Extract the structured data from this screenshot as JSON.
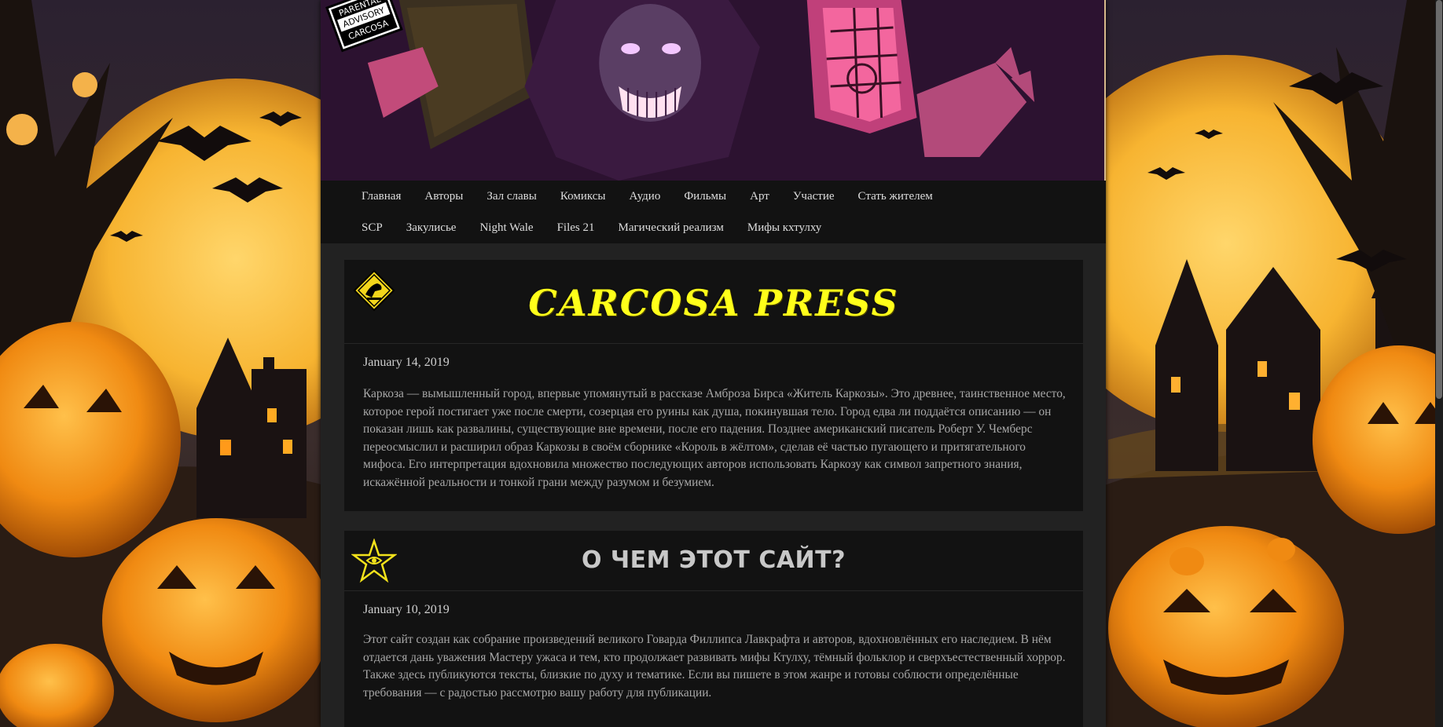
{
  "banner": {
    "advisory_line1": "PARENTAL",
    "advisory_line2": "ADVISORY",
    "advisory_line3": "CARCOSA"
  },
  "nav": {
    "row1": [
      "Главная",
      "Авторы",
      "Зал славы",
      "Комиксы",
      "Аудио",
      "Фильмы",
      "Арт",
      "Участие",
      "Стать жителем"
    ],
    "row2": [
      "SCP",
      "Закулисье",
      "Night Wale",
      "Files 21",
      "Магический реализм",
      "Мифы кхтулху"
    ]
  },
  "posts": [
    {
      "title": "CARCOSA PRESS",
      "icon": "warning-sign-icon",
      "date": "January 14, 2019",
      "body": "Каркоза — вымышленный город, впервые упомянутый в рассказе Амброза Бирса «Житель Каркозы». Это древнее, таинственное место, которое герой постигает уже после смерти, созерцая его руины как душа, покинувшая тело. Город едва ли поддаётся описанию — он показан лишь как развалины, существующие вне времени, после его падения. Позднее американский писатель Роберт У. Чемберс переосмыслил и расширил образ Каркозы в своём сборнике «Король в жёлтом», сделав её частью пугающего и притягательного мифоса. Его интерпретация вдохновила множество последующих авторов использовать Каркозу как символ запретного знания, искажённой реальности и тонкой грани между разумом и безумием."
    },
    {
      "title": "О ЧЕМ ЭТОТ САЙТ?",
      "icon": "elder-sign-icon",
      "date": "January 10, 2019",
      "body": "Этот сайт создан как собрание произведений великого Говарда Филлипса Лавкрафта и авторов, вдохновлённых его наследием. В нём отдается дань уважения Мастеру ужаса и тем, кто продолжает развивать мифы Ктулху, тёмный фольклор и сверхъестественный хоррор. Также здесь публикуются тексты, близкие по духу и тематике. Если вы пишете в этом жанре и готовы соблюсти определённые требования — с радостью рассмотрю вашу работу для публикации."
    }
  ],
  "colors": {
    "title_yellow": "#ffff1a",
    "page_bg": "#222222",
    "post_bg": "#121212",
    "pumpkin": "#f39a1d"
  }
}
